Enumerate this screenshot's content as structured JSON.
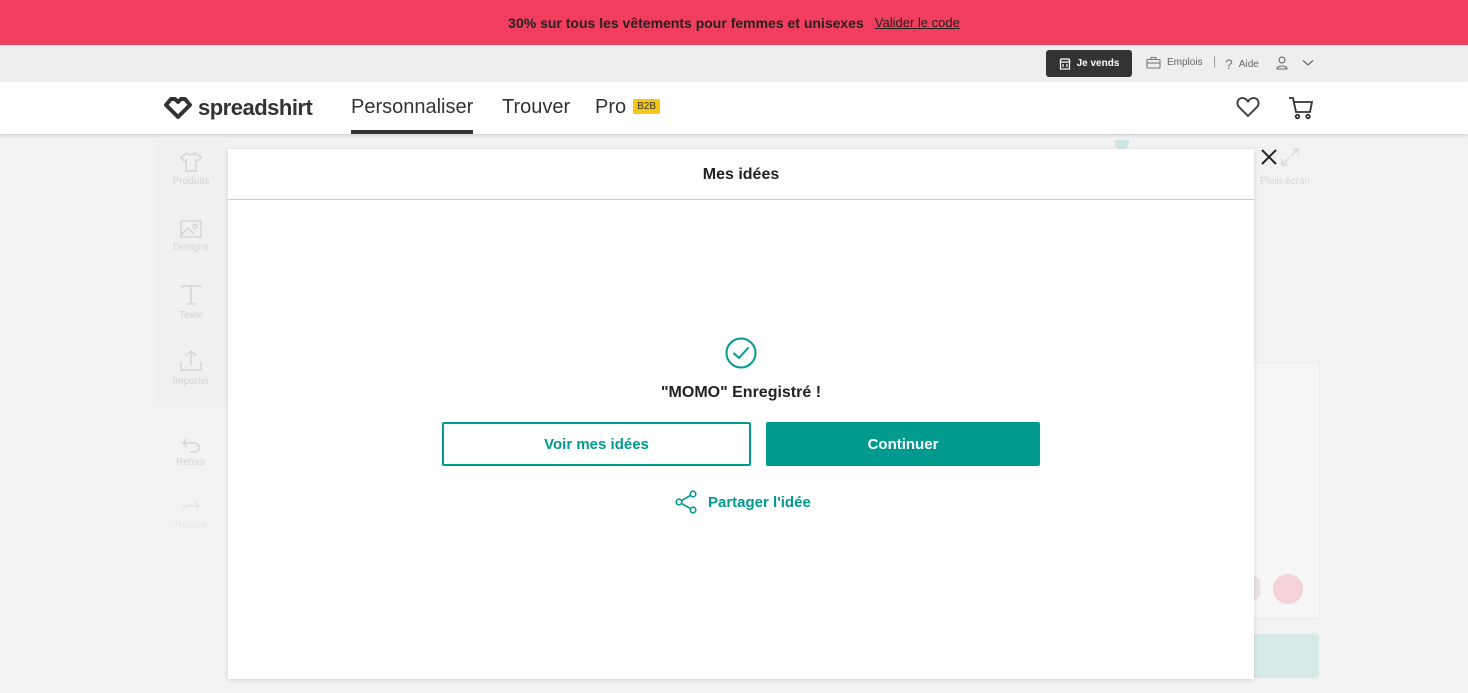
{
  "promo": {
    "text": "30% sur tous les vêtements pour femmes et unisexes",
    "link": "Valider le code"
  },
  "utility": {
    "sell_label": "Je vends",
    "jobs_label": "Emplois",
    "help_label": "Aide",
    "separator": "|"
  },
  "header": {
    "logo": "spreadshirt",
    "nav": [
      "Personnaliser",
      "Trouver",
      "Pro"
    ],
    "active_nav": "Personnaliser",
    "b2b_badge": "B2B"
  },
  "designer_tools": [
    "Produits",
    "Designs",
    "Texte",
    "Importer",
    "Retour",
    "Refaire"
  ],
  "fullscreen_label": "Plein écran",
  "modal": {
    "title": "Mes idées",
    "saved_message": "\"MOMO\" Enregistré !",
    "view_ideas_button": "Voir mes idées",
    "continue_button": "Continuer",
    "share_link": "Partager l'idée"
  },
  "colors": {
    "promo": "#f23e5e",
    "accent": "#009a8f",
    "b2b": "#f6c614"
  }
}
